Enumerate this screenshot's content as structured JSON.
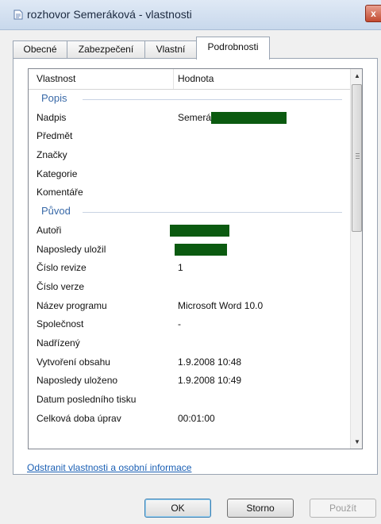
{
  "window": {
    "title": "rozhovor Semeráková - vlastnosti",
    "close_label": "x"
  },
  "tabs": [
    {
      "label": "Obecné"
    },
    {
      "label": "Zabezpečení"
    },
    {
      "label": "Vlastní"
    },
    {
      "label": "Podrobnosti",
      "active": true
    }
  ],
  "list": {
    "headers": {
      "property": "Vlastnost",
      "value": "Hodnota"
    },
    "rows": [
      {
        "type": "group",
        "label": "Popis"
      },
      {
        "type": "item",
        "key": "Nadpis",
        "value": "Semerá",
        "redacted": true
      },
      {
        "type": "item",
        "key": "Předmět",
        "value": ""
      },
      {
        "type": "item",
        "key": "Značky",
        "value": ""
      },
      {
        "type": "item",
        "key": "Kategorie",
        "value": ""
      },
      {
        "type": "item",
        "key": "Komentáře",
        "value": ""
      },
      {
        "type": "group",
        "label": "Původ"
      },
      {
        "type": "item",
        "key": "Autoři",
        "value": "",
        "redacted": true
      },
      {
        "type": "item",
        "key": "Naposledy uložil",
        "value": "",
        "redacted": true
      },
      {
        "type": "item",
        "key": "Číslo revize",
        "value": "1"
      },
      {
        "type": "item",
        "key": "Číslo verze",
        "value": ""
      },
      {
        "type": "item",
        "key": "Název programu",
        "value": "Microsoft Word 10.0"
      },
      {
        "type": "item",
        "key": "Společnost",
        "value": "-"
      },
      {
        "type": "item",
        "key": "Nadřízený",
        "value": ""
      },
      {
        "type": "item",
        "key": "Vytvoření obsahu",
        "value": "1.9.2008 10:48"
      },
      {
        "type": "item",
        "key": "Naposledy uloženo",
        "value": "1.9.2008 10:49"
      },
      {
        "type": "item",
        "key": "Datum posledního tisku",
        "value": ""
      },
      {
        "type": "item",
        "key": "Celková doba úprav",
        "value": "00:01:00"
      }
    ]
  },
  "link": {
    "label": "Odstranit vlastnosti a osobní informace"
  },
  "buttons": {
    "ok": "OK",
    "cancel": "Storno",
    "apply": "Použít"
  },
  "colors": {
    "redaction": "#0b5a10",
    "group_text": "#3a6aa8",
    "link": "#1a5fb4"
  }
}
